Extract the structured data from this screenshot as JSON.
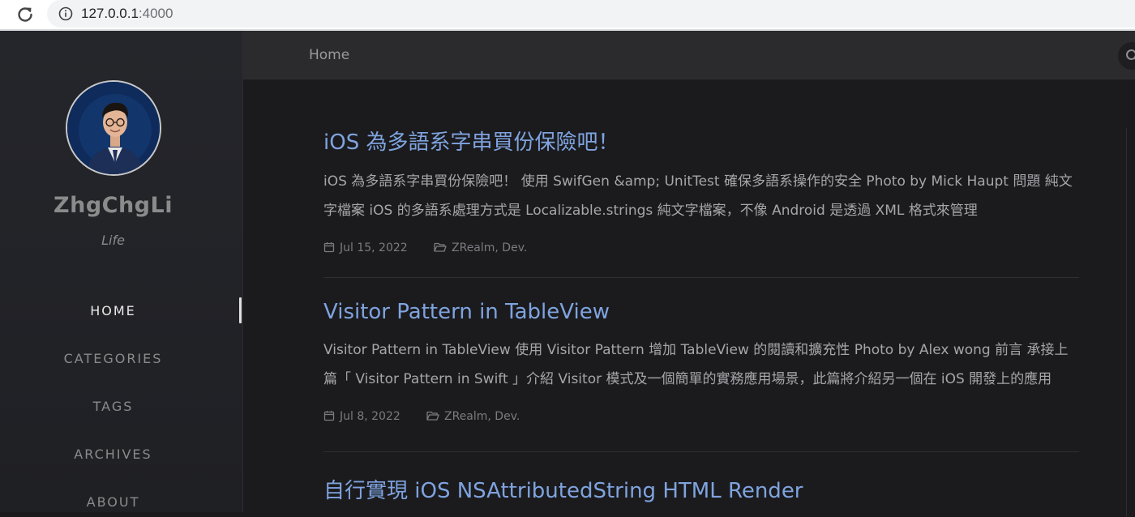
{
  "browser": {
    "url_host": "127.0.0.1",
    "url_port": ":4000"
  },
  "sidebar": {
    "site_title": "ZhgChgLi",
    "site_subtitle": "Life",
    "nav": [
      {
        "label": "HOME",
        "active": true
      },
      {
        "label": "CATEGORIES",
        "active": false
      },
      {
        "label": "TAGS",
        "active": false
      },
      {
        "label": "ARCHIVES",
        "active": false
      },
      {
        "label": "ABOUT",
        "active": false
      }
    ]
  },
  "topbar": {
    "title": "Home"
  },
  "posts": [
    {
      "title": "iOS 為多語系字串買份保險吧！",
      "excerpt": "iOS 為多語系字串買份保險吧！ 使用 SwifGen &amp; UnitTest 確保多語系操作的安全 Photo by Mick Haupt 問題 純文字檔案 iOS 的多語系處理方式是 Localizable.strings 純文字檔案，不像 Android 是透過 XML 格式來管理",
      "date": "Jul 15, 2022",
      "categories": "ZRealm, Dev."
    },
    {
      "title": "Visitor Pattern in TableView",
      "excerpt": "Visitor Pattern in TableView 使用 Visitor Pattern 增加 TableView 的閱讀和擴充性 Photo by Alex wong 前言 承接上篇「 Visitor Pattern in Swift 」介紹 Visitor 模式及一個簡單的實務應用場景，此篇將介紹另一個在 iOS 開發上的應用",
      "date": "Jul 8, 2022",
      "categories": "ZRealm, Dev."
    },
    {
      "title": "自行實現 iOS NSAttributedString HTML Render"
    }
  ],
  "colors": {
    "accent_link": "#7fa3de",
    "background": "#1b1b1e",
    "sidebar_bg": "#25262b"
  }
}
